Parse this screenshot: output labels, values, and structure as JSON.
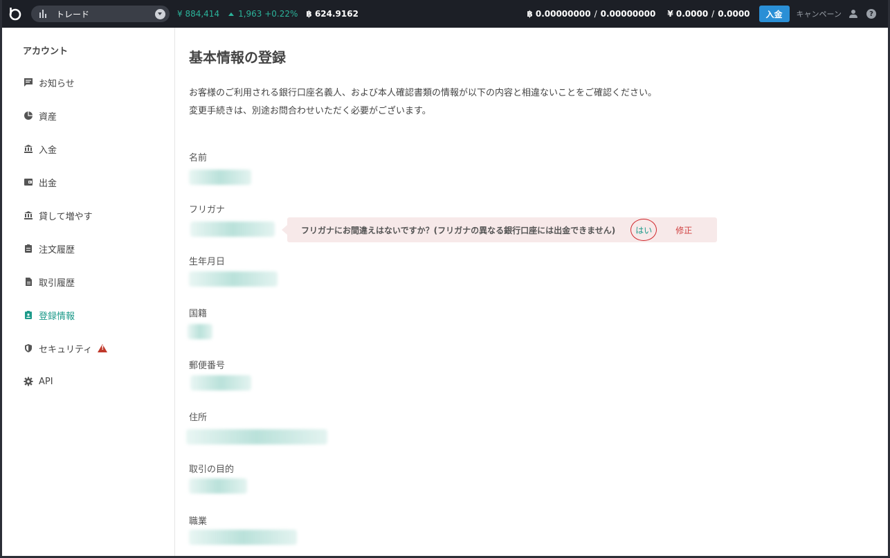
{
  "topbar": {
    "trade_label": "トレード",
    "price": "¥ 884,414",
    "change": "1,963 +0.22%",
    "btc_price": "624.9162",
    "btc_balance": "0.00000000",
    "btc_balance2": "0.00000000",
    "jpy_balance": "0.0000",
    "jpy_balance2": "0.0000",
    "separator": "/",
    "deposit_button": "入金",
    "campaign": "キャンペーン",
    "help": "?"
  },
  "sidebar": {
    "title": "アカウント",
    "items": [
      {
        "label": "お知らせ",
        "icon": "message-icon"
      },
      {
        "label": "資産",
        "icon": "pie-chart-icon"
      },
      {
        "label": "入金",
        "icon": "bank-icon"
      },
      {
        "label": "出金",
        "icon": "wallet-icon"
      },
      {
        "label": "貸して増やす",
        "icon": "bank-icon"
      },
      {
        "label": "注文履歴",
        "icon": "clipboard-icon"
      },
      {
        "label": "取引履歴",
        "icon": "document-icon"
      },
      {
        "label": "登録情報",
        "icon": "contact-card-icon",
        "active": true
      },
      {
        "label": "セキュリティ",
        "icon": "shield-icon"
      },
      {
        "label": "API",
        "icon": "gear-icon"
      }
    ]
  },
  "main": {
    "title": "基本情報の登録",
    "desc_line1": "お客様のご利用される銀行口座名義人、および本人確認書類の情報が以下の内容と相違ないことをご確認ください。",
    "desc_line2": "変更手続きは、別途お問合わせいただく必要がございます。",
    "fields": [
      {
        "label": "名前"
      },
      {
        "label": "フリガナ"
      },
      {
        "label": "生年月日"
      },
      {
        "label": "国籍"
      },
      {
        "label": "郵便番号"
      },
      {
        "label": "住所"
      },
      {
        "label": "取引の目的"
      },
      {
        "label": "職業"
      }
    ],
    "notice": {
      "message": "フリガナにお間違えはないですか？(フリガナの異なる銀行口座には出金できません)",
      "yes": "はい",
      "fix": "修正"
    }
  },
  "colors": {
    "accent": "#1e9a8a",
    "topbar": "#1c1f26",
    "deposit": "#2a8fd6",
    "danger": "#d04040"
  }
}
